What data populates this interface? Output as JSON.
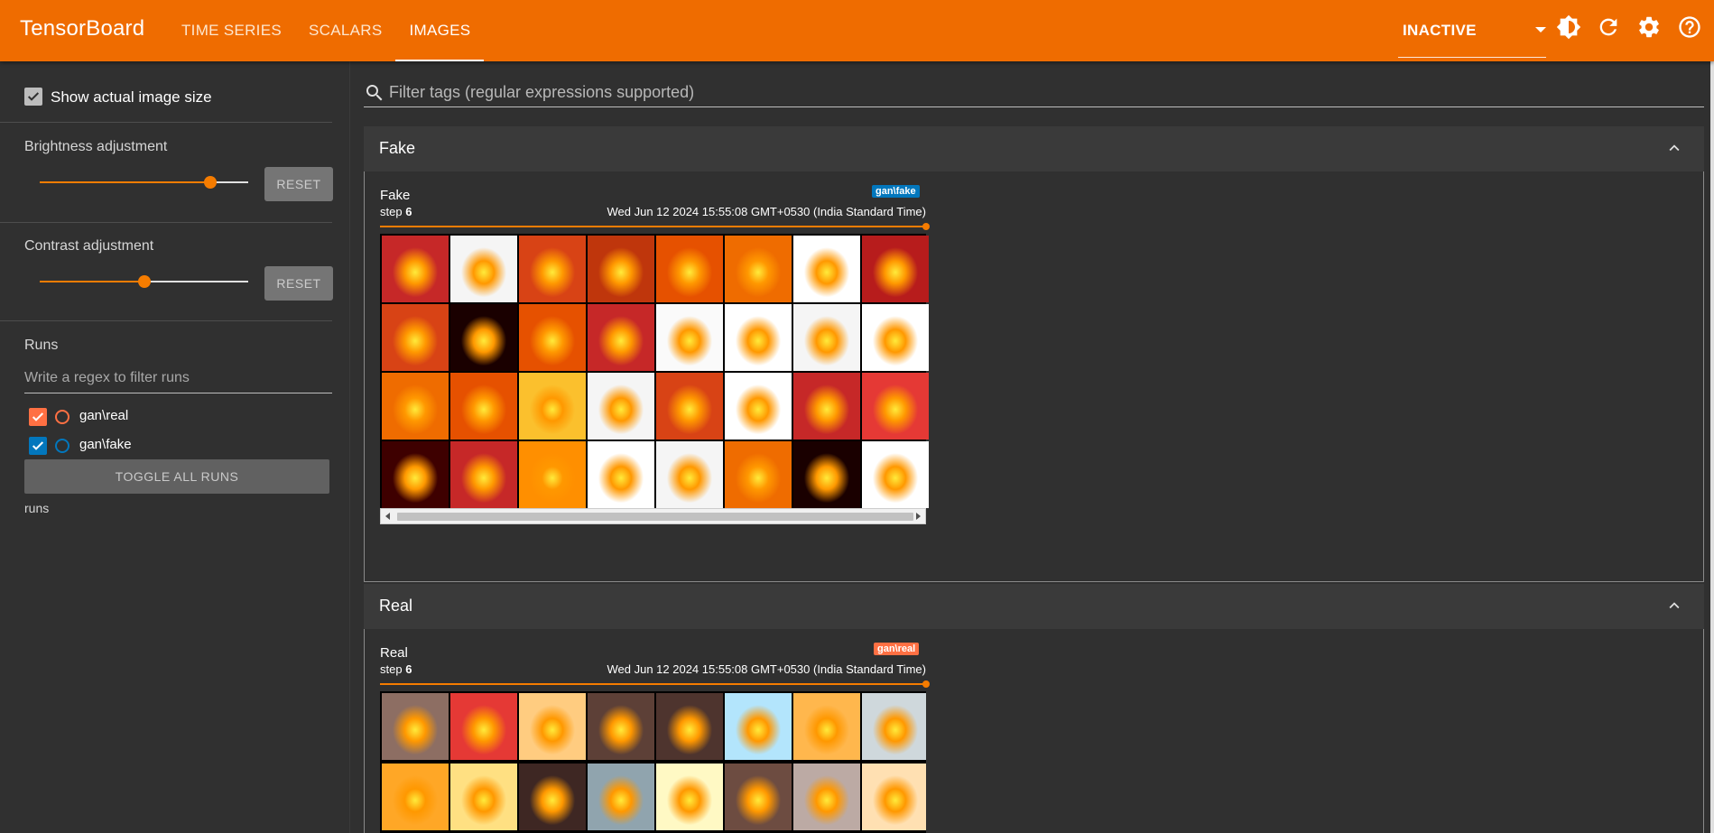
{
  "app": {
    "title": "TensorBoard"
  },
  "nav": {
    "tabs": [
      {
        "label": "TIME SERIES"
      },
      {
        "label": "SCALARS"
      },
      {
        "label": "IMAGES",
        "active": true
      }
    ]
  },
  "run_selector": {
    "value": "INACTIVE"
  },
  "sidebar": {
    "show_actual_size": {
      "label": "Show actual image size",
      "checked": true
    },
    "brightness": {
      "label": "Brightness adjustment",
      "value": 0.82,
      "reset_label": "RESET"
    },
    "contrast": {
      "label": "Contrast adjustment",
      "value": 0.5,
      "reset_label": "RESET"
    },
    "runs": {
      "title": "Runs",
      "filter_placeholder": "Write a regex to filter runs",
      "items": [
        {
          "name": "gan\\real",
          "color": "#ff7043",
          "checked": true
        },
        {
          "name": "gan\\fake",
          "color": "#0277bd",
          "checked": true
        }
      ],
      "toggle_label": "TOGGLE ALL RUNS",
      "footer": "runs"
    }
  },
  "filter": {
    "placeholder": "Filter tags (regular expressions supported)"
  },
  "groups": [
    {
      "header": "Fake",
      "card": {
        "title": "Fake",
        "step_label": "step",
        "step": "6",
        "timestamp": "Wed Jun 12 2024 15:55:08 GMT+0530 (India Standard Time)",
        "run": "gan\\fake",
        "run_color": "#0277bd",
        "tiles": [
          "#c62828",
          "#f5f5f5",
          "#d84315",
          "#bf360c",
          "#e65100",
          "#ef6c00",
          "#ffffff",
          "#b71c1c",
          "#d84315",
          "#1a0000",
          "#e65100",
          "#c62828",
          "#fafafa",
          "#ffffff",
          "#f5f5f5",
          "#ffffff",
          "#ef6c00",
          "#e65100",
          "#fbc02d",
          "#f5f5f5",
          "#d84315",
          "#ffffff",
          "#c62828",
          "#e53935",
          "#3e0000",
          "#c62828",
          "#ff8f00",
          "#ffffff",
          "#f5f5f5",
          "#ef6c00",
          "#1a0000",
          "#ffffff"
        ]
      }
    },
    {
      "header": "Real",
      "card": {
        "title": "Real",
        "step_label": "step",
        "step": "6",
        "timestamp": "Wed Jun 12 2024 15:55:08 GMT+0530 (India Standard Time)",
        "run": "gan\\real",
        "run_color": "#ff7043",
        "tiles": [
          "#8d6e63",
          "#e53935",
          "#ffcc80",
          "#5d4037",
          "#4e342e",
          "#b3e5fc",
          "#ffb74d",
          "#cfd8dc",
          "#ffa726",
          "#ffe082",
          "#3e2723",
          "#90a4ae",
          "#fff9c4",
          "#6d4c41",
          "#bcaaa4",
          "#ffe0b2"
        ]
      }
    }
  ]
}
